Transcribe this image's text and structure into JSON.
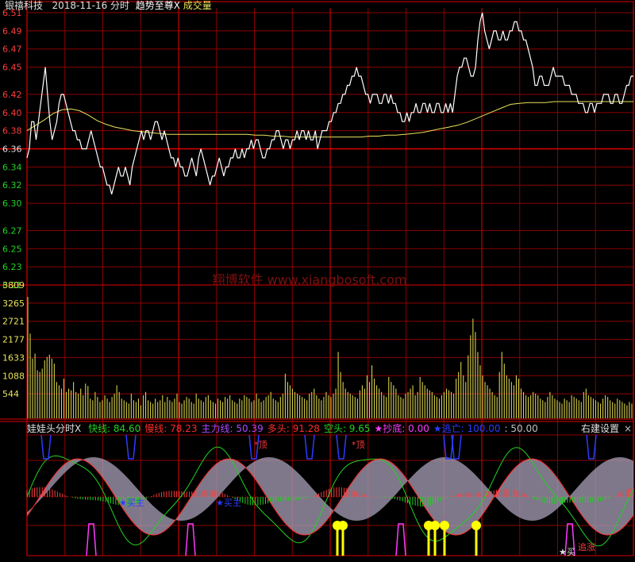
{
  "header": {
    "stock_name": "银禧科技",
    "date": "2018-11-16",
    "view": "分时",
    "indicator": "趋势至尊X",
    "volume_label": "成交量"
  },
  "watermark": "翔博软件 www.xiangbosoft.com",
  "colors": {
    "price": "#ffffff",
    "avg": "#e8e35a",
    "grid": "#8b0000",
    "frame": "#b40000",
    "axis_up": "#ff3c3c",
    "axis_down": "#21d321",
    "volume": "#d6d04a",
    "fast": "#21d321",
    "slow": "#ff2a2a",
    "main": "#b04aff",
    "band": "#a8a0b8",
    "top": "#2b3cff",
    "bottom": "#ff3cff",
    "signal": "#ffff00"
  },
  "price_axis": {
    "prev_close": "6.36",
    "labels": [
      "6.51",
      "6.49",
      "6.47",
      "6.45",
      "6.42",
      "6.40",
      "6.38",
      "6.36",
      "6.34",
      "6.32",
      "6.30",
      "6.27",
      "6.25",
      "6.23",
      "6.21"
    ],
    "values": [
      6.51,
      6.49,
      6.47,
      6.45,
      6.42,
      6.4,
      6.38,
      6.36,
      6.34,
      6.32,
      6.3,
      6.27,
      6.25,
      6.23,
      6.21
    ]
  },
  "volume_axis": {
    "labels": [
      "3809",
      "3265",
      "2721",
      "2177",
      "1633",
      "1088",
      "544"
    ],
    "values": [
      3809,
      3265,
      2721,
      2177,
      1633,
      1088,
      544
    ]
  },
  "indicator_panel": {
    "title": "娃娃头分时X",
    "items": [
      {
        "label": "快线:",
        "value": "84.60",
        "color": "#21d321"
      },
      {
        "label": "慢线:",
        "value": "78.23",
        "color": "#ff2a2a"
      },
      {
        "label": "主力线:",
        "value": "50.39",
        "color": "#b04aff"
      },
      {
        "label": "多头:",
        "value": "91.28",
        "color": "#ff2a2a"
      },
      {
        "label": "空头:",
        "value": "9.65",
        "color": "#21d321"
      },
      {
        "label": "★抄底:",
        "value": "0.00",
        "color": "#ff3cff"
      },
      {
        "label": "★逃亡:",
        "value": "100.00",
        "color": "#2b3cff"
      },
      {
        "label": ":",
        "value": "50.00",
        "color": "#c0c0c0"
      }
    ],
    "settings_button": "右建设置",
    "close": "×",
    "annotations": {
      "top": "*顶",
      "buy_main": "★买主",
      "chase": "追涨",
      "buy": "★买"
    }
  },
  "chart_data": [
    {
      "type": "line",
      "title": "2018-11-16 分时",
      "series": [
        {
          "name": "价格",
          "values": [
            6.35,
            6.36,
            6.39,
            6.39,
            6.37,
            6.39,
            6.41,
            6.43,
            6.45,
            6.42,
            6.39,
            6.37,
            6.38,
            6.39,
            6.41,
            6.42,
            6.42,
            6.41,
            6.4,
            6.39,
            6.38,
            6.38,
            6.37,
            6.37,
            6.36,
            6.36,
            6.36,
            6.37,
            6.38,
            6.37,
            6.36,
            6.35,
            6.34,
            6.34,
            6.33,
            6.32,
            6.32,
            6.31,
            6.32,
            6.33,
            6.34,
            6.33,
            6.33,
            6.34,
            6.33,
            6.32,
            6.34,
            6.35,
            6.36,
            6.37,
            6.38,
            6.37,
            6.38,
            6.38,
            6.37,
            6.38,
            6.39,
            6.39,
            6.38,
            6.37,
            6.38,
            6.37,
            6.36,
            6.35,
            6.35,
            6.34,
            6.35,
            6.34,
            6.34,
            6.33,
            6.33,
            6.34,
            6.35,
            6.34,
            6.33,
            6.35,
            6.36,
            6.35,
            6.34,
            6.33,
            6.32,
            6.33,
            6.33,
            6.34,
            6.35,
            6.34,
            6.33,
            6.34,
            6.34,
            6.35,
            6.35,
            6.36,
            6.35,
            6.35,
            6.36,
            6.35,
            6.36,
            6.36,
            6.37,
            6.36,
            6.37,
            6.37,
            6.36,
            6.35,
            6.35,
            6.36,
            6.36,
            6.37,
            6.37,
            6.38,
            6.38,
            6.37,
            6.36,
            6.37,
            6.37,
            6.36,
            6.37,
            6.37,
            6.38,
            6.37,
            6.38,
            6.38,
            6.37,
            6.38,
            6.37,
            6.37,
            6.38,
            6.36,
            6.37,
            6.38,
            6.38,
            6.38,
            6.39,
            6.39,
            6.4,
            6.4,
            6.41,
            6.41,
            6.42,
            6.42,
            6.43,
            6.43,
            6.44,
            6.44,
            6.45,
            6.44,
            6.44,
            6.43,
            6.42,
            6.42,
            6.41,
            6.42,
            6.42,
            6.42,
            6.41,
            6.41,
            6.42,
            6.42,
            6.41,
            6.42,
            6.41,
            6.41,
            6.4,
            6.4,
            6.39,
            6.39,
            6.4,
            6.39,
            6.4,
            6.4,
            6.41,
            6.4,
            6.4,
            6.41,
            6.41,
            6.4,
            6.41,
            6.4,
            6.4,
            6.41,
            6.41,
            6.4,
            6.4,
            6.41,
            6.4,
            6.41,
            6.4,
            6.42,
            6.44,
            6.45,
            6.45,
            6.46,
            6.46,
            6.45,
            6.44,
            6.44,
            6.45,
            6.48,
            6.5,
            6.51,
            6.49,
            6.48,
            6.47,
            6.48,
            6.49,
            6.49,
            6.48,
            6.48,
            6.49,
            6.48,
            6.48,
            6.49,
            6.49,
            6.5,
            6.5,
            6.49,
            6.49,
            6.48,
            6.48,
            6.47,
            6.46,
            6.45,
            6.43,
            6.43,
            6.44,
            6.44,
            6.43,
            6.43,
            6.43,
            6.44,
            6.45,
            6.44,
            6.44,
            6.44,
            6.44,
            6.43,
            6.43,
            6.43,
            6.42,
            6.42,
            6.42,
            6.41,
            6.41,
            6.41,
            6.4,
            6.4,
            6.41,
            6.41,
            6.4,
            6.41,
            6.41,
            6.41,
            6.42,
            6.42,
            6.42,
            6.41,
            6.41,
            6.42,
            6.42,
            6.41,
            6.41,
            6.42,
            6.43,
            6.43,
            6.44,
            6.44
          ]
        },
        {
          "name": "均价",
          "values": [
            6.38,
            6.386,
            6.392,
            6.399,
            6.403,
            6.404,
            6.402,
            6.397,
            6.391,
            6.387,
            6.384,
            6.382,
            6.38,
            6.379,
            6.378,
            6.377,
            6.376,
            6.376,
            6.376,
            6.376,
            6.376,
            6.376,
            6.376,
            6.376,
            6.376,
            6.376,
            6.375,
            6.375,
            6.374,
            6.374,
            6.373,
            6.373,
            6.373,
            6.373,
            6.373,
            6.373,
            6.373,
            6.373,
            6.373,
            6.374,
            6.374,
            6.375,
            6.375,
            6.376,
            6.377,
            6.378,
            6.38,
            6.382,
            6.384,
            6.386,
            6.389,
            6.393,
            6.397,
            6.401,
            6.405,
            6.409,
            6.41,
            6.411,
            6.411,
            6.411,
            6.412,
            6.412,
            6.412,
            6.412,
            6.412,
            6.412,
            6.412,
            6.412,
            6.412,
            6.412
          ]
        }
      ]
    },
    {
      "type": "bar",
      "title": "成交量",
      "values": [
        3450,
        2350,
        1600,
        1750,
        1250,
        1200,
        1300,
        1550,
        1650,
        1720,
        1600,
        1450,
        900,
        800,
        700,
        1000,
        600,
        700,
        650,
        900,
        600,
        550,
        700,
        500,
        850,
        780,
        400,
        350,
        600,
        450,
        300,
        350,
        500,
        400,
        300,
        450,
        550,
        800,
        600,
        400,
        350,
        300,
        250,
        550,
        350,
        300,
        400,
        200,
        500,
        600,
        350,
        300,
        250,
        400,
        300,
        350,
        500,
        300,
        450,
        350,
        300,
        400,
        550,
        300,
        250,
        350,
        450,
        400,
        300,
        250,
        550,
        400,
        350,
        300,
        450,
        500,
        350,
        300,
        250,
        400,
        350,
        300,
        450,
        400,
        500,
        350,
        300,
        250,
        400,
        350,
        500,
        450,
        400,
        300,
        350,
        550,
        400,
        300,
        350,
        450,
        500,
        600,
        400,
        350,
        300,
        450,
        550,
        1150,
        900,
        800,
        700,
        600,
        550,
        500,
        450,
        400,
        350,
        550,
        600,
        700,
        500,
        400,
        350,
        450,
        600,
        500,
        450,
        550,
        700,
        1800,
        1200,
        900,
        700,
        600,
        550,
        500,
        450,
        400,
        650,
        800,
        700,
        1100,
        900,
        1400,
        1000,
        800,
        700,
        600,
        500,
        450,
        1050,
        900,
        800,
        700,
        500,
        450,
        400,
        550,
        600,
        700,
        800,
        500,
        600,
        1050,
        900,
        800,
        700,
        650,
        600,
        500,
        450,
        400,
        500,
        600,
        700,
        650,
        600,
        550,
        1000,
        1200,
        1500,
        1100,
        900,
        1700,
        2300,
        2800,
        2400,
        1800,
        1400,
        1100,
        900,
        800,
        700,
        600,
        500,
        450,
        1200,
        1800,
        1450,
        1100,
        1000,
        900,
        800,
        1100,
        1000,
        700,
        600,
        500,
        450,
        500,
        600,
        550,
        500,
        400,
        350,
        300,
        450,
        600,
        500,
        400,
        350,
        300,
        250,
        400,
        350,
        300,
        500,
        450,
        400,
        350,
        300,
        600,
        700,
        500,
        450,
        400,
        350,
        300,
        250,
        400,
        500,
        450,
        350,
        300,
        250,
        400,
        350,
        300,
        250,
        200,
        300,
        250
      ],
      "ylim": [
        0,
        3809
      ]
    }
  ]
}
